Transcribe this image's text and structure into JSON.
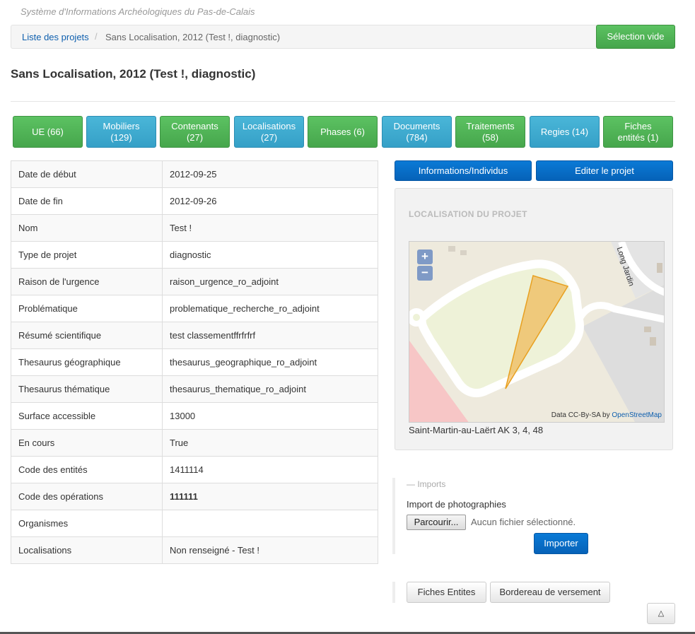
{
  "site": {
    "title": "Système d'Informations Archéologiques du Pas-de-Calais"
  },
  "breadcrumb": {
    "parent": "Liste des projets",
    "separator": "/",
    "current": "Sans Localisation, 2012 (Test !, diagnostic)"
  },
  "header": {
    "selection_button": "Sélection vide"
  },
  "page": {
    "title": "Sans Localisation, 2012 (Test !, diagnostic)"
  },
  "tabs": [
    {
      "label": "UE (66)",
      "color": "#4cae4c"
    },
    {
      "label": "Mobiliers\n(129)",
      "color": "#39a6cc"
    },
    {
      "label": "Contenants\n(27)",
      "color": "#4cae4c"
    },
    {
      "label": "Localisations\n(27)",
      "color": "#39a6cc"
    },
    {
      "label": "Phases (6)",
      "color": "#4cae4c"
    },
    {
      "label": "Documents\n(784)",
      "color": "#39a6cc"
    },
    {
      "label": "Traitements\n(58)",
      "color": "#4cae4c"
    },
    {
      "label": "Regies (14)",
      "color": "#39a6cc"
    },
    {
      "label": "Fiches\nentités (1)",
      "color": "#4cae4c"
    }
  ],
  "details": [
    {
      "label": "Date de début",
      "value": "2012-09-25"
    },
    {
      "label": "Date de fin",
      "value": "2012-09-26"
    },
    {
      "label": "Nom",
      "value": "Test !"
    },
    {
      "label": "Type de projet",
      "value": "diagnostic"
    },
    {
      "label": "Raison de l'urgence",
      "value": "raison_urgence_ro_adjoint"
    },
    {
      "label": "Problématique",
      "value": "problematique_recherche_ro_adjoint"
    },
    {
      "label": "Résumé scientifique",
      "value": "test classementffrfrfrf"
    },
    {
      "label": "Thesaurus géographique",
      "value": "thesaurus_geographique_ro_adjoint"
    },
    {
      "label": "Thesaurus thématique",
      "value": "thesaurus_thematique_ro_adjoint"
    },
    {
      "label": "Surface accessible",
      "value": "13000"
    },
    {
      "label": "En cours",
      "value": "True"
    },
    {
      "label": "Code des entités",
      "value": "1411114"
    },
    {
      "label": "Code des opérations",
      "value": "111111"
    },
    {
      "label": "Organismes",
      "value": ""
    },
    {
      "label": "Localisations",
      "value": "Non renseigné - Test !"
    }
  ],
  "actions": {
    "info_button": "Informations/Individus",
    "edit_button": "Editer le projet"
  },
  "map": {
    "heading": "LOCALISATION DU PROJET",
    "zoom_in": "+",
    "zoom_out": "−",
    "attribution_prefix": "Data CC-By-SA by ",
    "attribution_link": "OpenStreetMap",
    "road_name": "Long Jardin",
    "caption": "Saint-Martin-au-Laërt AK 3, 4, 48",
    "polygon_color": "#f0a830"
  },
  "imports": {
    "legend": "— Imports",
    "label": "Import de photographies",
    "browse_button": "Parcourir...",
    "file_status": "Aucun fichier sélectionné.",
    "import_button": "Importer"
  },
  "bottom": {
    "entities_button": "Fiches Entites",
    "bordereau_button": "Bordereau de versement",
    "top_button": "△"
  }
}
